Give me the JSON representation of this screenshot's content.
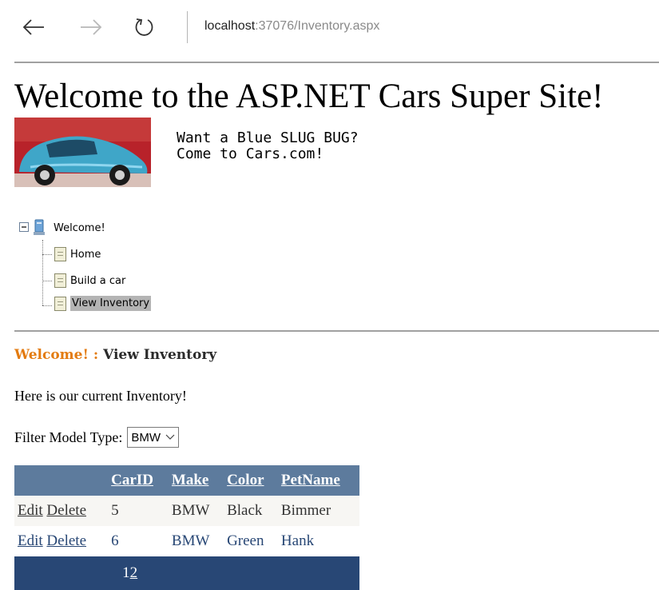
{
  "browser": {
    "address_host": "localhost",
    "address_rest": ":37076/Inventory.aspx"
  },
  "page": {
    "title": "Welcome to the ASP.NET Cars Super Site!",
    "ad_line1": "Want a Blue SLUG BUG?",
    "ad_line2": "Come to Cars.com!"
  },
  "tree": {
    "root": "Welcome!",
    "items": [
      {
        "label": "Home"
      },
      {
        "label": "Build a car"
      },
      {
        "label": "View Inventory"
      }
    ]
  },
  "breadcrumb": {
    "root": "Welcome!",
    "separator": ":",
    "current": "View Inventory"
  },
  "intro": "Here is our current Inventory!",
  "filter": {
    "label": "Filter Model Type:",
    "selected": "BMW"
  },
  "grid": {
    "headers": [
      "CarID",
      "Make",
      "Color",
      "PetName"
    ],
    "edit_label": "Edit",
    "delete_label": "Delete",
    "rows": [
      {
        "carid": "5",
        "make": "BMW",
        "color": "Black",
        "petname": "Bimmer"
      },
      {
        "carid": "6",
        "make": "BMW",
        "color": "Green",
        "petname": "Hank"
      }
    ],
    "pager": {
      "current": "1",
      "next": "2"
    }
  },
  "colors": {
    "header_bg": "#5d7b9d",
    "pager_bg": "#284775",
    "breadcrumb_root": "#e37b10"
  }
}
